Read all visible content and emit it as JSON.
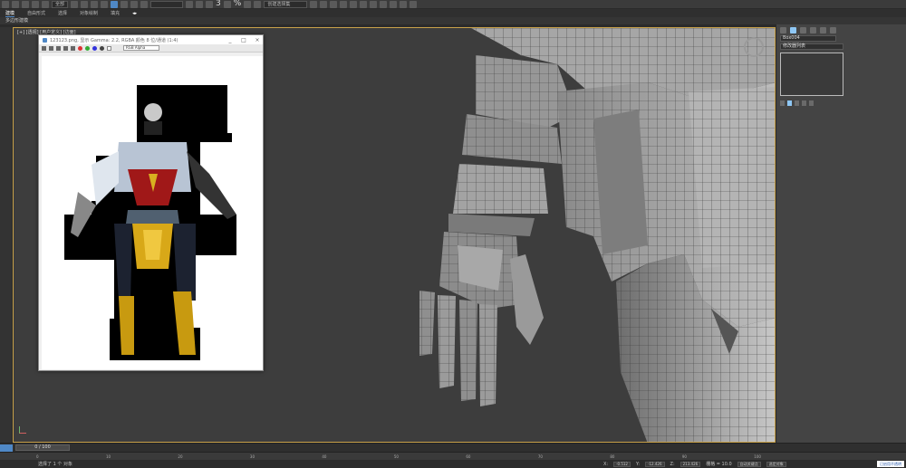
{
  "toolbar": {
    "selection_filter": "全部",
    "snap_number": "3",
    "percent_icon": "%",
    "named_selection": "创建选择集"
  },
  "menubar": {
    "items": [
      "建模",
      "自由形式",
      "选择",
      "对象绘制",
      "填充"
    ],
    "active_index": 0
  },
  "subbar": {
    "label": "多边形建模"
  },
  "viewport": {
    "label": "[+] [透视] [用户定义] [边面]",
    "border_color": "#c9a24a"
  },
  "image_window": {
    "title": "123123.png, 显示 Gamma: 2.2, RGBA 颜色 8 位/通道 (1:4)",
    "channel_select": "RGB Alpha",
    "controls": [
      "_",
      "□",
      "×"
    ]
  },
  "command_panel": {
    "object_name": "Box004",
    "modifier_list": "修改器列表"
  },
  "timeline": {
    "frame_display": "0 / 100",
    "ruler_labels": [
      "0",
      "10",
      "20",
      "30",
      "40",
      "50",
      "60",
      "70",
      "80",
      "90",
      "100"
    ]
  },
  "statusbar": {
    "status_text": "选择了 1 个 对象",
    "x_label": "X:",
    "x_value": "-0.512",
    "y_label": "Y:",
    "y_value": "-12.426",
    "z_label": "Z:",
    "z_value": "213.426",
    "grid": "栅格 = 10.0",
    "autokey": "自动关键点",
    "selected": "选定对象",
    "setkey": "设置关键点",
    "link": "已启用不透明"
  },
  "icons": [
    "undo-icon",
    "redo-icon",
    "link-icon",
    "select-icon",
    "move-icon",
    "rotate-icon",
    "scale-icon",
    "snap-icon",
    "percent-snap-icon",
    "mirror-icon",
    "align-icon",
    "render-icon",
    "viewcube-icon"
  ],
  "colors": {
    "accent": "#4f88c6",
    "viewport_border": "#c9a24a",
    "panel_tab_active": "#8ec7f5"
  }
}
